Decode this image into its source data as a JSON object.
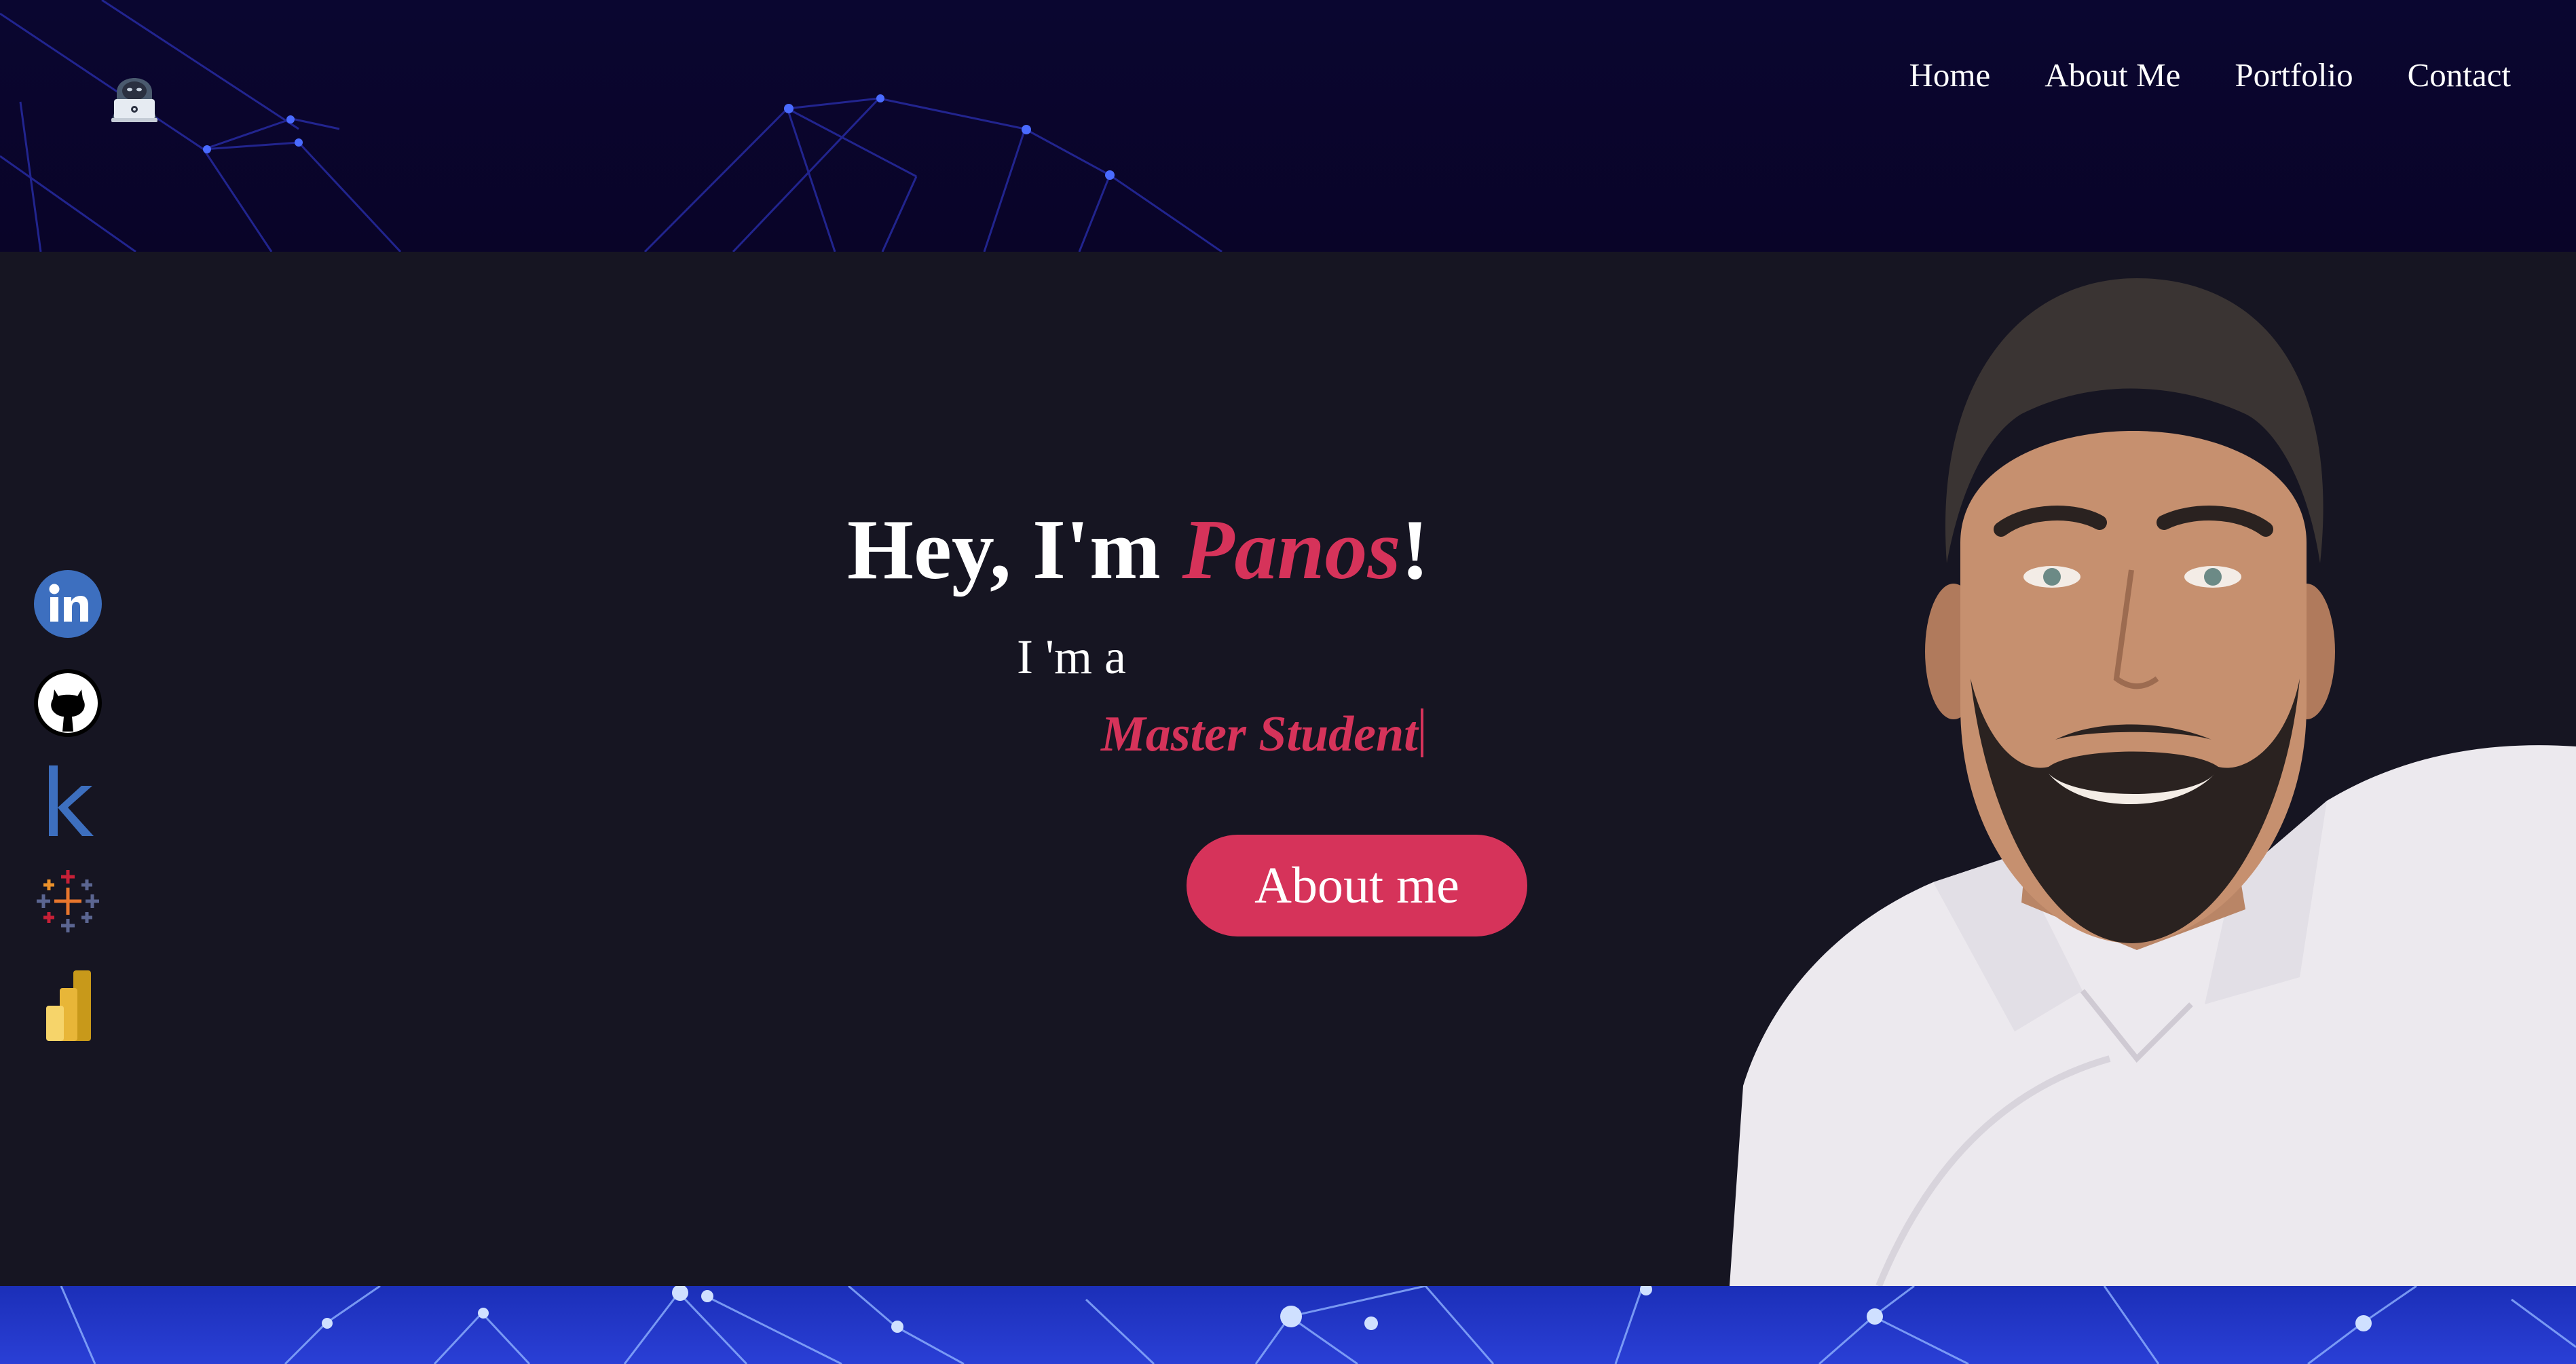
{
  "nav": {
    "items": [
      {
        "label": "Home"
      },
      {
        "label": "About Me"
      },
      {
        "label": "Portfolio"
      },
      {
        "label": "Contact"
      }
    ]
  },
  "hero": {
    "greeting_prefix": "Hey, I'm ",
    "name": "Panos",
    "greeting_suffix": "!",
    "intro": "I 'm a",
    "role": "Master Student",
    "button_label": "About me"
  },
  "social": {
    "icons": [
      "linkedin-icon",
      "github-icon",
      "kaggle-icon",
      "tableau-icon",
      "powerbi-icon"
    ]
  },
  "colors": {
    "background": "#161522",
    "accent": "#d6335a",
    "banner_top": "#0a0630",
    "banner_bottom": "#1b2fb8",
    "text": "#ffffff"
  }
}
